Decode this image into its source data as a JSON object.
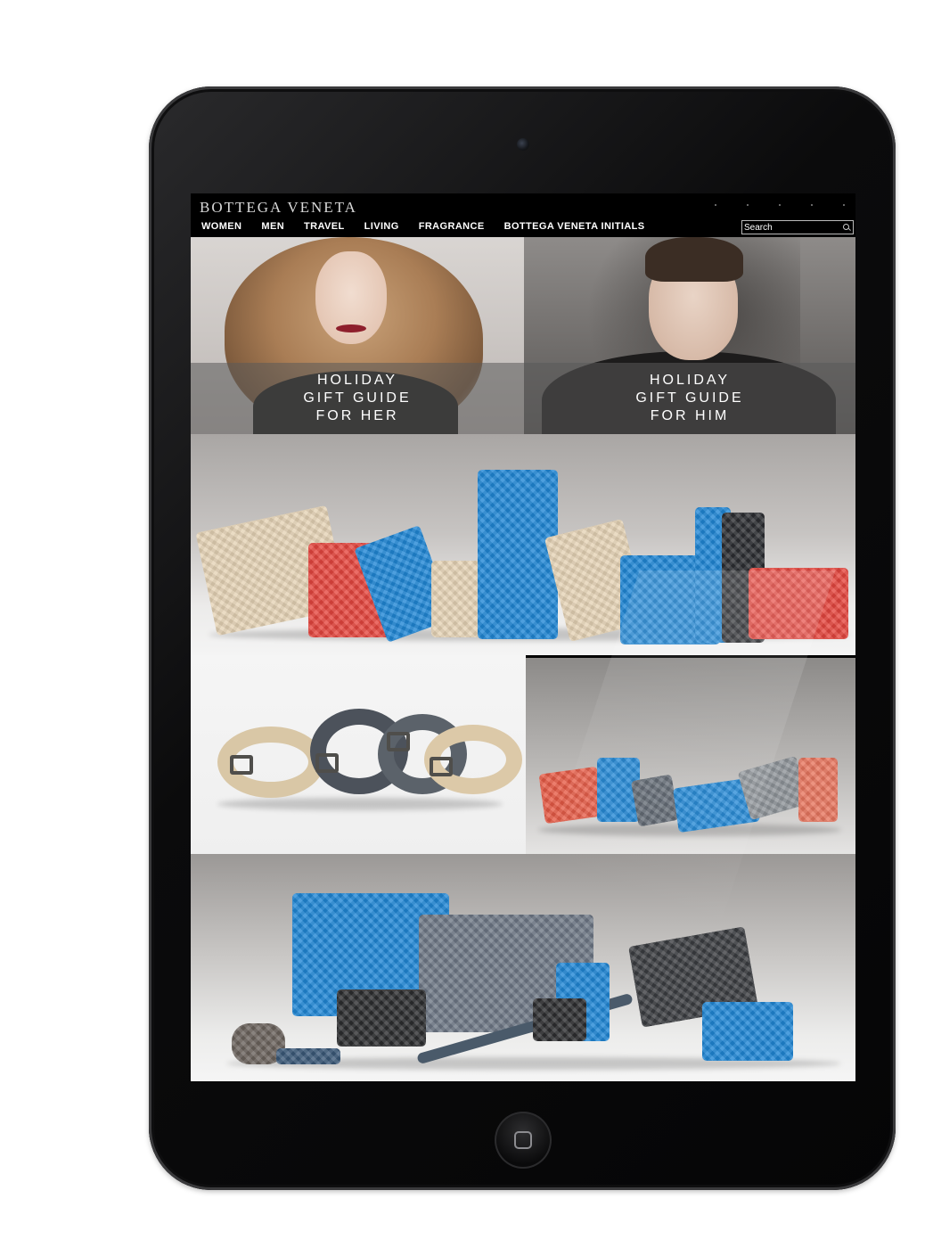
{
  "site": {
    "logo": "BOTTEGA VENETA"
  },
  "nav": {
    "items": [
      {
        "label": "WOMEN"
      },
      {
        "label": "MEN"
      },
      {
        "label": "TRAVEL"
      },
      {
        "label": "LIVING"
      },
      {
        "label": "FRAGRANCE"
      },
      {
        "label": "BOTTEGA VENETA INITIALS"
      }
    ]
  },
  "search": {
    "placeholder": "Search"
  },
  "promos": {
    "her": {
      "line1": "HOLIDAY",
      "line2": "GIFT GUIDE",
      "line3": "FOR HER"
    },
    "him": {
      "line1": "HOLIDAY",
      "line2": "GIFT GUIDE",
      "line3": "FOR HIM"
    }
  },
  "colors": {
    "accent_blue": "#1f86d5",
    "accent_red": "#e5463e",
    "beige": "#e5d3b5",
    "slate": "#5e6670"
  },
  "icons": {
    "search": "search-icon",
    "camera": "camera-icon",
    "home": "home-button-icon"
  }
}
